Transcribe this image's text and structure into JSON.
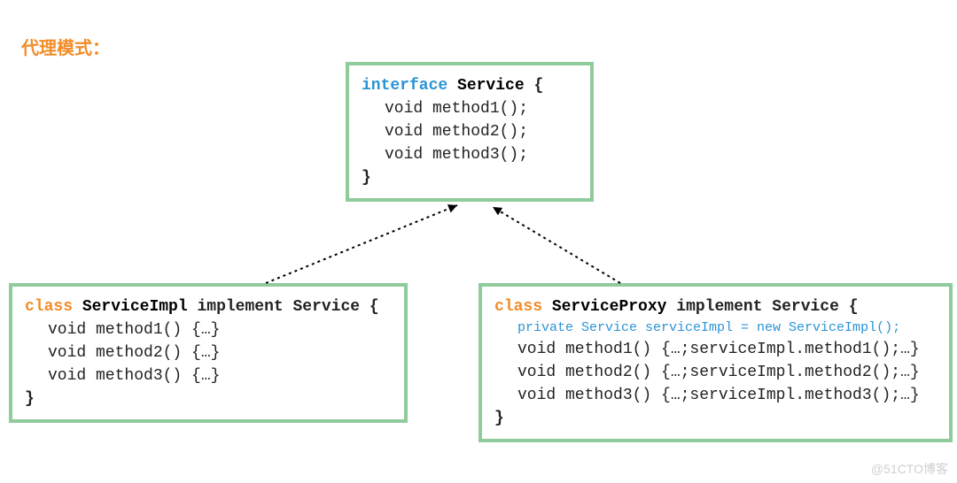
{
  "title": "代理模式：",
  "interfaceBox": {
    "keyword": "interface",
    "name": "Service",
    "openBrace": "{",
    "lines": [
      "void method1();",
      "void method2();",
      "void method3();"
    ],
    "closeBrace": "}"
  },
  "implBox": {
    "keyword": "class",
    "name": "ServiceImpl",
    "rest": "implement Service {",
    "lines": [
      "void method1() {…}",
      "void method2() {…}",
      "void method3() {…}"
    ],
    "closeBrace": "}"
  },
  "proxyBox": {
    "keyword": "class",
    "name": "ServiceProxy",
    "rest": "implement Service {",
    "field": "private Service serviceImpl = new ServiceImpl();",
    "lines": [
      "void method1() {…;serviceImpl.method1();…}",
      "void method2() {…;serviceImpl.method2();…}",
      "void method3() {…;serviceImpl.method3();…}"
    ],
    "closeBrace": "}"
  },
  "watermark": "@51CTO博客",
  "colors": {
    "border": "#8FCB9B",
    "title": "#F28C28",
    "interfaceKw": "#2A93D5",
    "classKw": "#F28C28"
  }
}
